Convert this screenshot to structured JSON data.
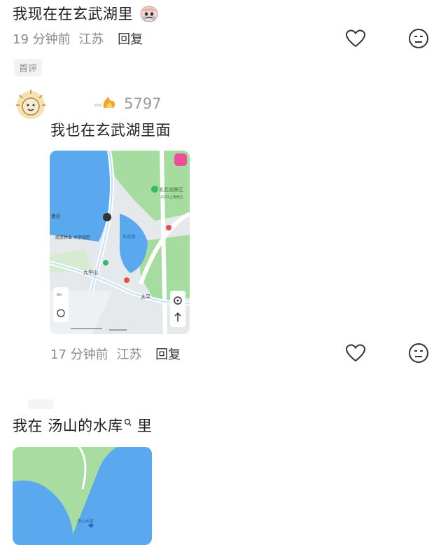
{
  "comment1": {
    "text": "我现在在玄武湖里",
    "time": "19 分钟前",
    "location": "江苏",
    "reply_label": "回复",
    "tag": "首评"
  },
  "comment2": {
    "level_count": "5797",
    "text": "我也在玄武湖里面",
    "time": "17 分钟前",
    "location": "江苏",
    "reply_label": "回复",
    "map": {
      "labels": {
        "scenic": "玄武湖景区",
        "scenic_sub": "2023上榜景区",
        "area": "景区",
        "university": "南京林业\n大学校区",
        "jiuhua": "九华山",
        "taiping": "太平",
        "lake": "玄武湖"
      }
    }
  },
  "comment3": {
    "text_pre": "我在",
    "text_keyword": "汤山的水库",
    "text_post": "里",
    "map_label": "汤山水库"
  },
  "colors": {
    "water": "#5aaaf0",
    "green": "#9ed89a",
    "road": "#ffffff",
    "meta": "#8a8a8a"
  }
}
